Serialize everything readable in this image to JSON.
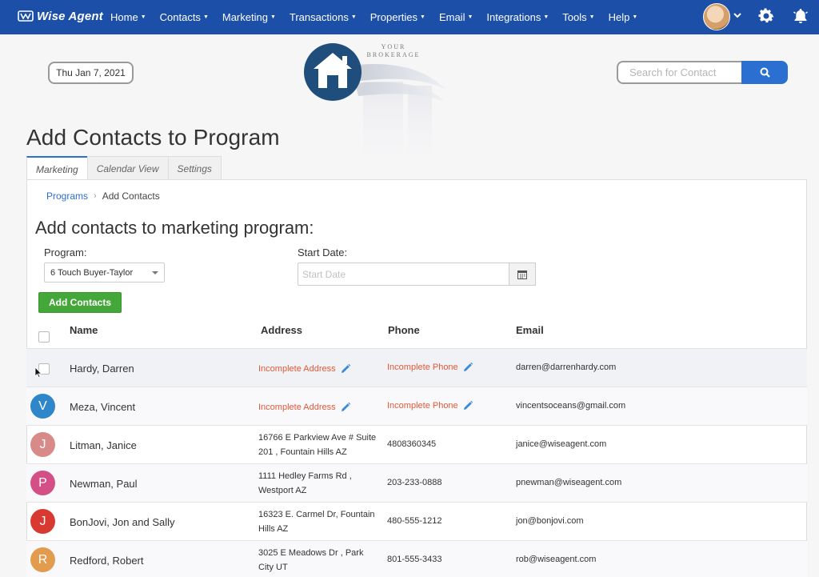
{
  "app": {
    "logo_text": "Wise Agent",
    "nav": [
      {
        "label": "Home"
      },
      {
        "label": "Contacts"
      },
      {
        "label": "Marketing"
      },
      {
        "label": "Transactions"
      },
      {
        "label": "Properties"
      },
      {
        "label": "Email"
      },
      {
        "label": "Integrations"
      },
      {
        "label": "Tools"
      },
      {
        "label": "Help"
      }
    ]
  },
  "header": {
    "date": "Thu Jan 7, 2021",
    "brand_line1": "YOUR",
    "brand_line2": "BROKERAGE",
    "search_placeholder": "Search for Contact"
  },
  "page": {
    "title": "Add Contacts to Program",
    "tabs": [
      {
        "label": "Marketing",
        "active": true
      },
      {
        "label": "Calendar View"
      },
      {
        "label": "Settings"
      }
    ],
    "breadcrumb": {
      "link": "Programs",
      "current": "Add Contacts"
    },
    "section_title": "Add contacts to marketing program:",
    "program_label": "Program:",
    "program_value": "6 Touch Buyer-Taylor",
    "start_label": "Start Date:",
    "start_placeholder": "Start Date",
    "add_button": "Add Contacts"
  },
  "table": {
    "headers": {
      "name": "Name",
      "address": "Address",
      "phone": "Phone",
      "email": "Email"
    },
    "rows": [
      {
        "initial": "",
        "color": "",
        "name": "Hardy, Darren",
        "address": "Incomplete Address",
        "address2": "",
        "address_incomplete": true,
        "phone": "Incomplete Phone",
        "phone_incomplete": true,
        "email": "darren@darrenhardy.com"
      },
      {
        "initial": "V",
        "color": "#2f86c8",
        "name": "Meza, Vincent",
        "address": "Incomplete Address",
        "address2": "",
        "address_incomplete": true,
        "phone": "Incomplete Phone",
        "phone_incomplete": true,
        "email": "vincentsoceans@gmail.com"
      },
      {
        "initial": "J",
        "color": "#d88a88",
        "name": "Litman, Janice",
        "address": "16766 E Parkview Ave # Suite",
        "address2": "201 , Fountain Hills AZ",
        "address_incomplete": false,
        "phone": "4808360345",
        "phone_incomplete": false,
        "email": "janice@wiseagent.com"
      },
      {
        "initial": "P",
        "color": "#d44f86",
        "name": "Newman, Paul",
        "address": "1111 Hedley Farms Rd ,",
        "address2": "Westport AZ",
        "address_incomplete": false,
        "phone": "203-233-0888",
        "phone_incomplete": false,
        "email": "pnewman@wiseagent.com"
      },
      {
        "initial": "J",
        "color": "#d83a32",
        "name": "BonJovi, Jon and Sally",
        "address": "16323 E. Carmel Dr, Fountain",
        "address2": "Hills AZ",
        "address_incomplete": false,
        "phone": "480-555-1212",
        "phone_incomplete": false,
        "email": "jon@bonjovi.com"
      },
      {
        "initial": "R",
        "color": "#e39b4e",
        "name": "Redford, Robert",
        "address": "3025 E Meadows Dr , Park",
        "address2": "City UT",
        "address_incomplete": false,
        "phone": "801-555-3433",
        "phone_incomplete": false,
        "email": "rob@wiseagent.com"
      }
    ]
  }
}
